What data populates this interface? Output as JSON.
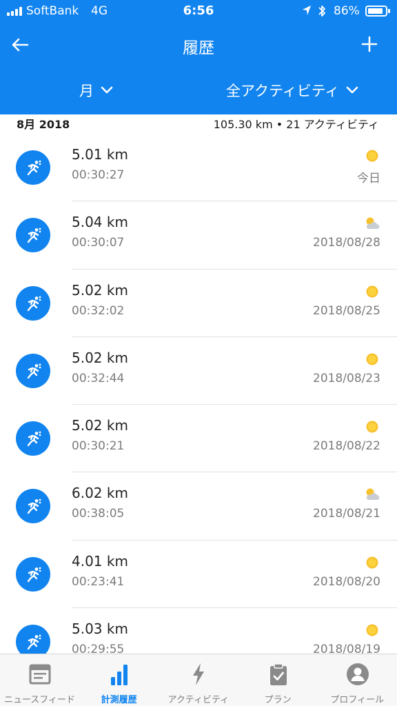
{
  "status_bar": {
    "carrier": "SoftBank",
    "network": "4G",
    "time": "6:56",
    "battery_pct": "86%",
    "battery_level": 0.86
  },
  "header": {
    "title": "履歴",
    "back_icon": "back-arrow-icon",
    "add_icon": "plus-icon",
    "filter_period": "月",
    "filter_activity": "全アクティビティ",
    "accent_color": "#1184f0"
  },
  "summary": {
    "month": "8月 2018",
    "totals": "105.30 km • 21 アクティビティ"
  },
  "activities": [
    {
      "distance": "5.01 km",
      "duration": "00:30:27",
      "date": "今日",
      "weather": "sun"
    },
    {
      "distance": "5.04 km",
      "duration": "00:30:07",
      "date": "2018/08/28",
      "weather": "cloud"
    },
    {
      "distance": "5.02 km",
      "duration": "00:32:02",
      "date": "2018/08/25",
      "weather": "sun"
    },
    {
      "distance": "5.02 km",
      "duration": "00:32:44",
      "date": "2018/08/23",
      "weather": "sun"
    },
    {
      "distance": "5.02 km",
      "duration": "00:30:21",
      "date": "2018/08/22",
      "weather": "sun"
    },
    {
      "distance": "6.02 km",
      "duration": "00:38:05",
      "date": "2018/08/21",
      "weather": "cloud"
    },
    {
      "distance": "4.01 km",
      "duration": "00:23:41",
      "date": "2018/08/20",
      "weather": "sun"
    },
    {
      "distance": "5.03 km",
      "duration": "00:29:55",
      "date": "2018/08/19",
      "weather": "sun"
    }
  ],
  "tabs": [
    {
      "label": "ニュースフィード",
      "icon": "newsfeed-icon",
      "active": false
    },
    {
      "label": "計測履歴",
      "icon": "bar-chart-icon",
      "active": true
    },
    {
      "label": "アクティビティ",
      "icon": "lightning-icon",
      "active": false
    },
    {
      "label": "プラン",
      "icon": "clipboard-icon",
      "active": false
    },
    {
      "label": "プロフィール",
      "icon": "profile-icon",
      "active": false
    }
  ]
}
